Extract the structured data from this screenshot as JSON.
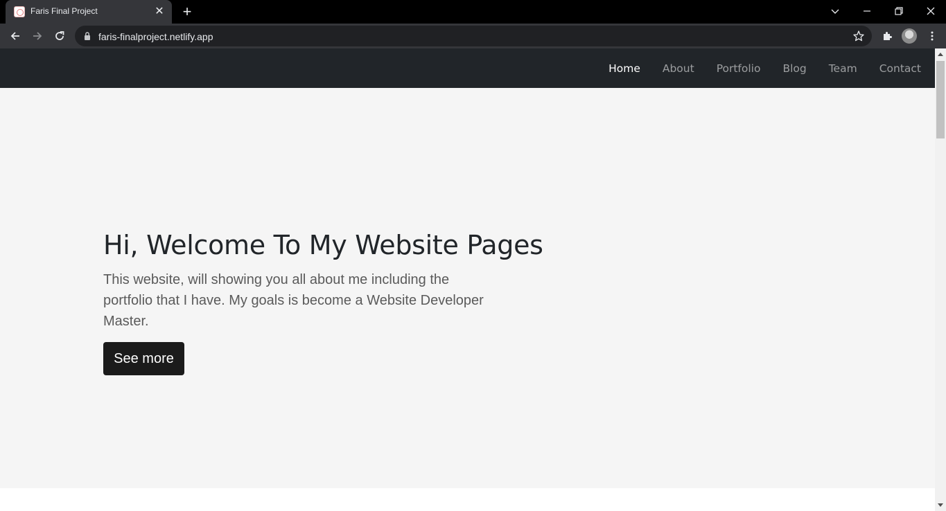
{
  "browser": {
    "tab": {
      "title": "Faris Final Project",
      "close_glyph": "✕"
    },
    "new_tab_glyph": "+",
    "address": {
      "url": "faris-finalproject.netlify.app"
    },
    "icons": {
      "back": "arrow-left-icon",
      "forward": "arrow-right-icon",
      "reload": "reload-icon",
      "lock": "lock-icon",
      "bookmark": "star-icon",
      "extensions": "puzzle-icon",
      "menu": "kebab-menu-icon",
      "tab_search": "chevron-down-icon",
      "minimize": "minimize-icon",
      "restore": "restore-icon",
      "close": "close-icon"
    },
    "colors": {
      "frame": "#000000",
      "toolbar": "#35363a",
      "omnibox": "#202124"
    }
  },
  "site": {
    "nav": {
      "items": [
        {
          "label": "Home",
          "active": true
        },
        {
          "label": "About",
          "active": false
        },
        {
          "label": "Portfolio",
          "active": false
        },
        {
          "label": "Blog",
          "active": false
        },
        {
          "label": "Team",
          "active": false
        },
        {
          "label": "Contact",
          "active": false
        }
      ]
    },
    "hero": {
      "title": "Hi, Welcome To My Website Pages",
      "text": "This website, will showing you all about me including the portfolio that I have. My goals is become a Website Developer Master.",
      "button_label": "See more"
    },
    "colors": {
      "navbar": "#212529",
      "hero_bg": "#f5f5f5",
      "button": "#1b1b1b"
    }
  }
}
